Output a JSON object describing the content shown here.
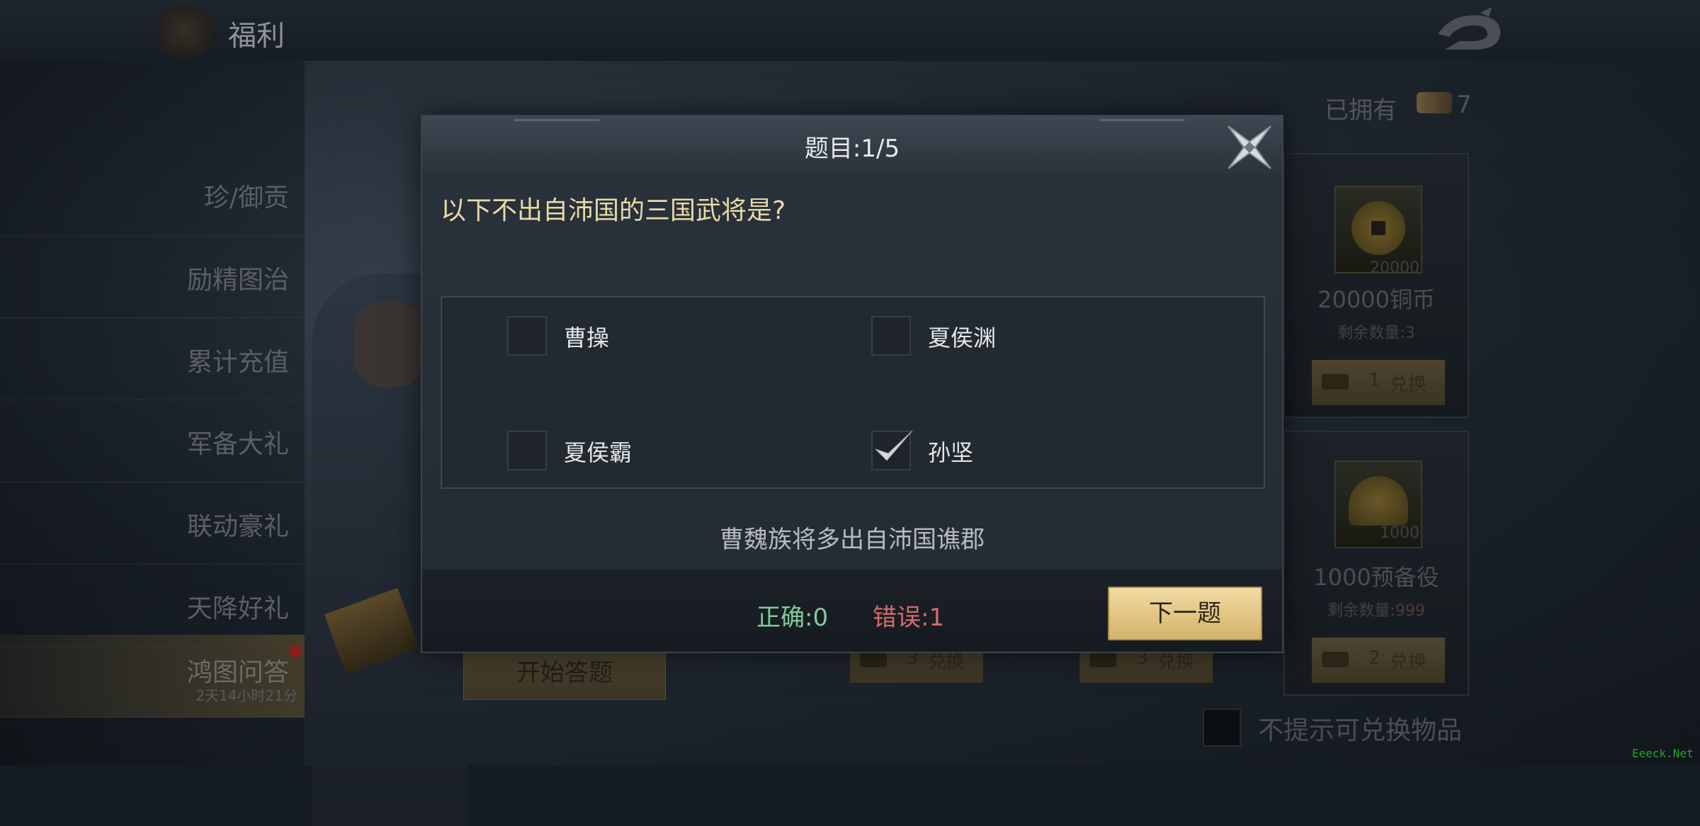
{
  "header": {
    "title": "福利"
  },
  "sidebar": {
    "items": [
      {
        "label": "珍/御贡"
      },
      {
        "label": "励精图治"
      },
      {
        "label": "累计充值"
      },
      {
        "label": "军备大礼"
      },
      {
        "label": "联动豪礼"
      },
      {
        "label": "天降好礼"
      },
      {
        "label": "鸿图问答",
        "sub": "2天14小时21分",
        "active": true
      }
    ]
  },
  "owned": {
    "label": "已拥有",
    "count": "7"
  },
  "start_button": "开始答题",
  "cards": [
    {
      "qty": "20000",
      "name": "20000铜币",
      "remain_label": "剩余数量:",
      "remain_value": "3",
      "cost": "1",
      "exchange": "兑换"
    },
    {
      "qty": "1000",
      "name": "1000预备役",
      "remain_label": "剩余数量:",
      "remain_value": "999",
      "cost": "2",
      "exchange": "兑换"
    }
  ],
  "behind_buttons": [
    {
      "cost": "3",
      "exchange": "兑换"
    },
    {
      "cost": "3",
      "exchange": "兑换"
    }
  ],
  "no_prompt_label": "不提示可兑换物品",
  "watermark": "Eeeck.Net",
  "quiz": {
    "title": "题目:1/5",
    "question": "以下不出自沛国的三国武将是?",
    "options": [
      {
        "label": "曹操",
        "checked": false
      },
      {
        "label": "夏侯渊",
        "checked": false
      },
      {
        "label": "夏侯霸",
        "checked": false
      },
      {
        "label": "孙坚",
        "checked": true
      }
    ],
    "hint": "曹魏族将多出自沛国谯郡",
    "correct": "正确:0",
    "wrong": "错误:1",
    "next_button": "下一题"
  },
  "colors": {
    "gold_button": "#e6c987",
    "correct_green": "#83c99a",
    "wrong_red": "#d56b6b",
    "question_yellow": "#e8d9a8"
  }
}
